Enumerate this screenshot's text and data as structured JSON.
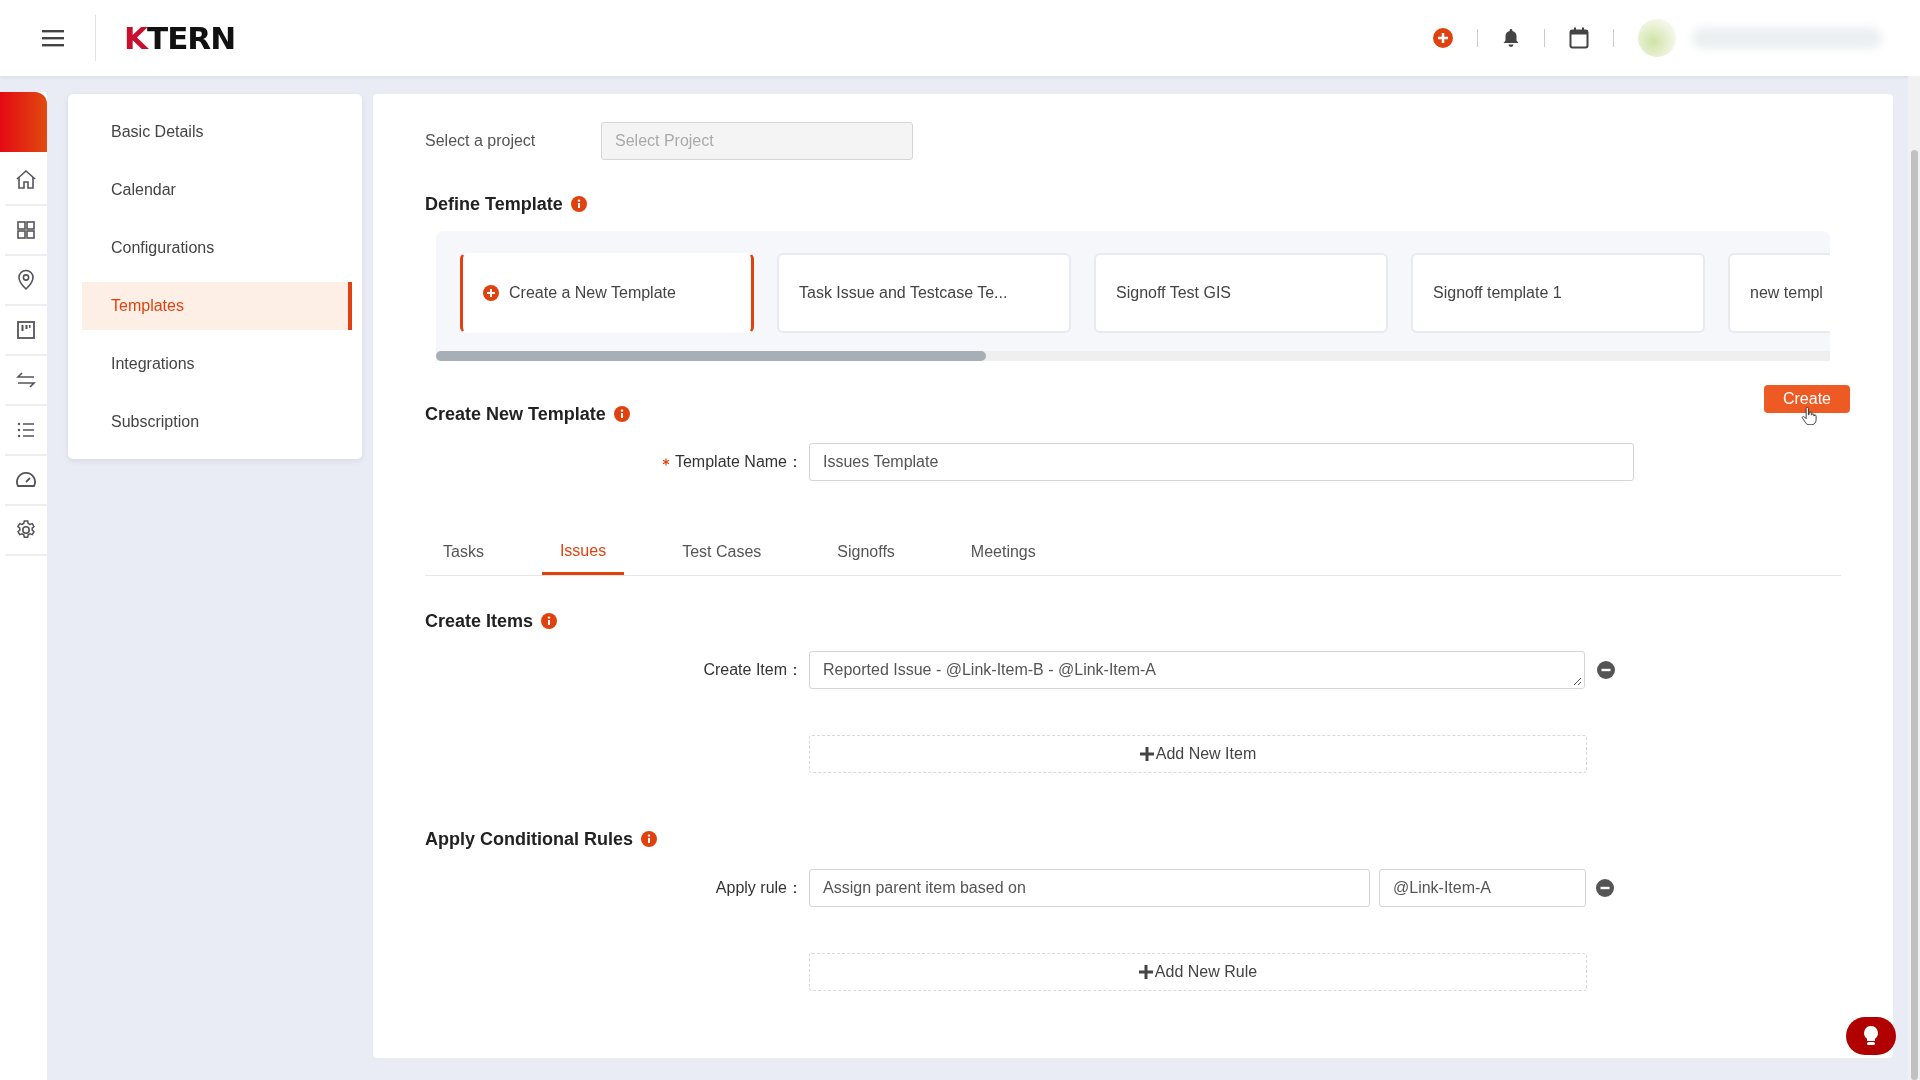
{
  "header": {
    "logo": "KTERN"
  },
  "rail": {
    "items": [
      {
        "kind": "home"
      },
      {
        "kind": "grid"
      },
      {
        "kind": "pin"
      },
      {
        "kind": "board"
      },
      {
        "kind": "swap"
      },
      {
        "kind": "list"
      },
      {
        "kind": "gauge"
      },
      {
        "kind": "gear"
      }
    ]
  },
  "settings_menu": {
    "items": [
      {
        "label": "Basic Details",
        "selected": false
      },
      {
        "label": "Calendar",
        "selected": false
      },
      {
        "label": "Configurations",
        "selected": false
      },
      {
        "label": "Templates",
        "selected": true
      },
      {
        "label": "Integrations",
        "selected": false
      },
      {
        "label": "Subscription",
        "selected": false
      }
    ]
  },
  "project": {
    "label": "Select a project",
    "placeholder": "Select Project"
  },
  "define_template": {
    "title": "Define Template",
    "cards": [
      {
        "kind": "new",
        "label": "Create a New Template",
        "selected": true
      },
      {
        "kind": "template",
        "label": "Task Issue and Testcase Te...",
        "selected": false
      },
      {
        "kind": "template",
        "label": "Signoff Test GIS",
        "selected": false
      },
      {
        "kind": "template",
        "label": "Signoff template 1",
        "selected": false
      },
      {
        "kind": "template",
        "label": "new templ",
        "selected": false
      }
    ]
  },
  "create_template": {
    "title": "Create New Template",
    "button": "Create",
    "name_label": "Template Name：",
    "required": true,
    "name_value": "Issues Template"
  },
  "tabs": [
    {
      "label": "Tasks",
      "selected": false
    },
    {
      "label": "Issues",
      "selected": true
    },
    {
      "label": "Test Cases",
      "selected": false
    },
    {
      "label": "Signoffs",
      "selected": false
    },
    {
      "label": "Meetings",
      "selected": false
    }
  ],
  "create_items": {
    "title": "Create Items",
    "label": "Create Item：",
    "values": [
      "Reported Issue - @Link-Item-B - @Link-Item-A"
    ],
    "add": "Add New Item"
  },
  "rules": {
    "title": "Apply Conditional Rules",
    "label": "Apply rule：",
    "rows": [
      {
        "condition": "Assign parent item based on",
        "target": "@Link-Item-A"
      }
    ],
    "add": "Add New Rule"
  }
}
